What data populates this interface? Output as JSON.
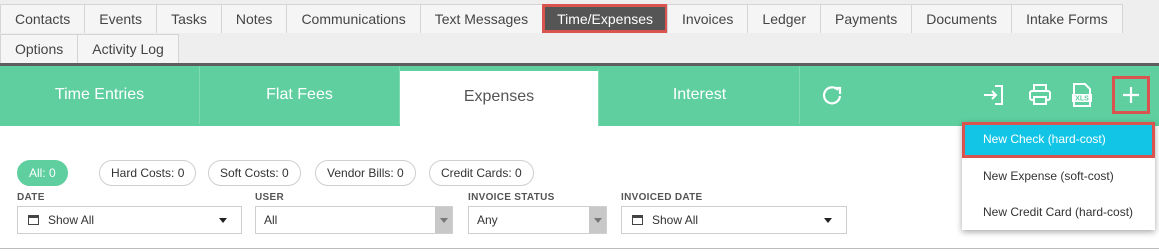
{
  "top_tabs": {
    "row1": [
      "Contacts",
      "Events",
      "Tasks",
      "Notes",
      "Communications",
      "Text Messages",
      "Time/Expenses",
      "Invoices",
      "Ledger",
      "Payments",
      "Documents",
      "Intake Forms"
    ],
    "row2": [
      "Options",
      "Activity Log"
    ],
    "active": "Time/Expenses"
  },
  "sub_tabs": {
    "items": [
      "Time Entries",
      "Flat Fees",
      "Expenses",
      "Interest"
    ],
    "active": "Expenses"
  },
  "toolbar_icons": [
    "refresh-icon",
    "import-icon",
    "print-icon",
    "xls-export-icon",
    "plus-icon"
  ],
  "filters": {
    "all": "All: 0",
    "hard_costs": "Hard Costs:",
    "hard_costs_count": "0",
    "soft_costs": "Soft Costs:",
    "soft_costs_count": "0",
    "vendor_bills": "Vendor Bills:",
    "vendor_bills_count": "0",
    "credit_cards": "Credit Cards:",
    "credit_cards_count": "0"
  },
  "fields": {
    "date_label": "DATE",
    "date_value": "Show All",
    "user_label": "USER",
    "user_value": "All",
    "invoice_status_label": "INVOICE STATUS",
    "invoice_status_value": "Any",
    "invoiced_date_label": "INVOICED DATE",
    "invoiced_date_value": "Show All"
  },
  "dropdown": {
    "items": [
      "New Check (hard-cost)",
      "New Expense (soft-cost)",
      "New Credit Card (hard-cost)"
    ],
    "active": "New Check (hard-cost)"
  },
  "colors": {
    "accent_green": "#5fcfa0",
    "highlight_red": "#d9534f",
    "dropdown_active": "#12c5e6"
  }
}
